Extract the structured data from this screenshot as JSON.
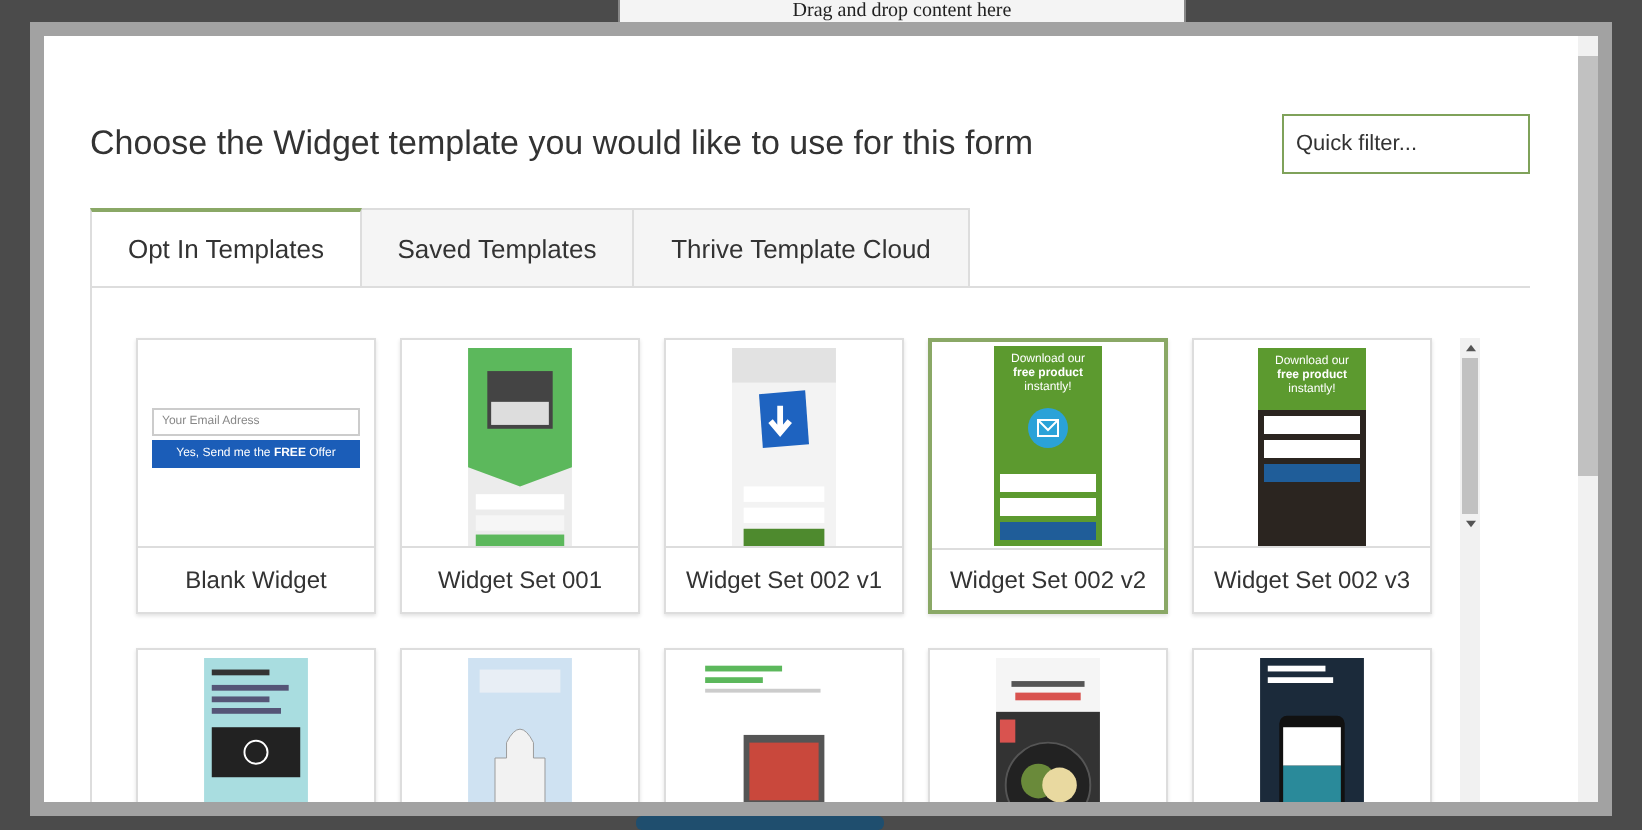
{
  "background": {
    "drop_hint": "Drag and drop content here"
  },
  "dialog": {
    "title": "Choose the Widget template you would like to use for this form",
    "search": {
      "placeholder": "Quick filter..."
    },
    "tabs": [
      {
        "label": "Opt In Templates",
        "selected": true
      },
      {
        "label": "Saved Templates",
        "selected": false
      },
      {
        "label": "Thrive Template Cloud",
        "selected": false
      }
    ],
    "templates": [
      {
        "name": "Blank Widget",
        "selected": false,
        "kind": "blank",
        "preview_texts": [
          "Your Email Adress",
          "Yes, Send me the **FREE** Offer"
        ]
      },
      {
        "name": "Widget Set 001",
        "selected": false,
        "kind": "green-banner"
      },
      {
        "name": "Widget Set 002 v1",
        "selected": false,
        "kind": "download-box"
      },
      {
        "name": "Widget Set 002 v2",
        "selected": true,
        "kind": "green-mail",
        "preview_texts": [
          "Download our",
          "free product",
          "instantly!"
        ]
      },
      {
        "name": "Widget Set 002 v3",
        "selected": false,
        "kind": "dark-photo",
        "preview_texts": [
          "Download our",
          "free product",
          "instantly!"
        ]
      },
      {
        "selected": false,
        "kind": "video"
      },
      {
        "selected": false,
        "kind": "city"
      },
      {
        "selected": false,
        "kind": "pizza"
      },
      {
        "selected": false,
        "kind": "food"
      },
      {
        "selected": false,
        "kind": "phone"
      }
    ]
  }
}
